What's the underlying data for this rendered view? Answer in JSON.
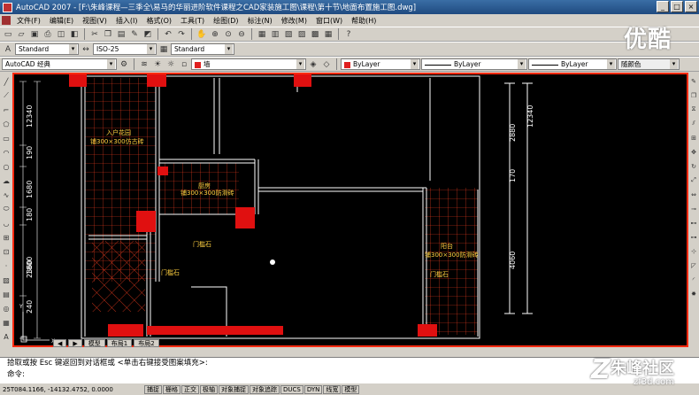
{
  "window": {
    "title": "AutoCAD 2007 - [F:\\朱峰课程—三季全\\易马的华丽进阶软件课程之CAD家装施工图\\课程\\第十节\\地面布置施工图.dwg]",
    "min_label": "_",
    "max_label": "□",
    "close_label": "×"
  },
  "menu": {
    "items": [
      "文件(F)",
      "编辑(E)",
      "视图(V)",
      "插入(I)",
      "格式(O)",
      "工具(T)",
      "绘图(D)",
      "标注(N)",
      "修改(M)",
      "窗口(W)",
      "帮助(H)"
    ]
  },
  "toolbar2": {
    "text_style": "Standard",
    "dim_style": "ISO-25",
    "table_style": "Standard"
  },
  "toolbar3": {
    "workspace": "AutoCAD 经典",
    "layer": "墙",
    "color": "ByLayer",
    "linetype": "ByLayer",
    "lineweight": "ByLayer",
    "plotstyle": "随颜色"
  },
  "watermark": "优酷",
  "drawing": {
    "rooms": {
      "entry_name": "入户花园",
      "entry_tile": "铺300×300仿古砖",
      "kitchen_name": "厨房",
      "kitchen_tile": "铺300×300防滑砖",
      "balcony_name": "阳台",
      "balcony_tile": "铺300×300防滑砖",
      "door_stone_1": "门槛石",
      "door_stone_2": "门槛石",
      "door_stone_3": "门槛石"
    },
    "dims_left": [
      "12340",
      "190",
      "1680",
      "180",
      "1800",
      "2360",
      "240"
    ],
    "dims_right": [
      "2880",
      "170",
      "4060",
      "12340"
    ]
  },
  "tabs": [
    "◀",
    "▶",
    "模型",
    "布局1",
    "布局2"
  ],
  "command": {
    "line1": "拾取或按 Esc 键返回到对话框或 <单击右键接受图案填充>:",
    "line2": "命令:"
  },
  "status": {
    "coords": "25T084.1166, -14132.4752, 0.0000",
    "buttons": [
      "捕捉",
      "栅格",
      "正交",
      "极轴",
      "对象捕捉",
      "对象追踪",
      "DUCS",
      "DYN",
      "线宽",
      "模型"
    ]
  },
  "logo": {
    "mark": "Z",
    "text": "朱峰社区",
    "sub": "zf3d.com"
  },
  "colors": {
    "accent_frame": "#ff2a10",
    "canvas": "#000000",
    "wall": "#ffffff",
    "hatch": "#ff4020",
    "label": "#ffd040"
  }
}
